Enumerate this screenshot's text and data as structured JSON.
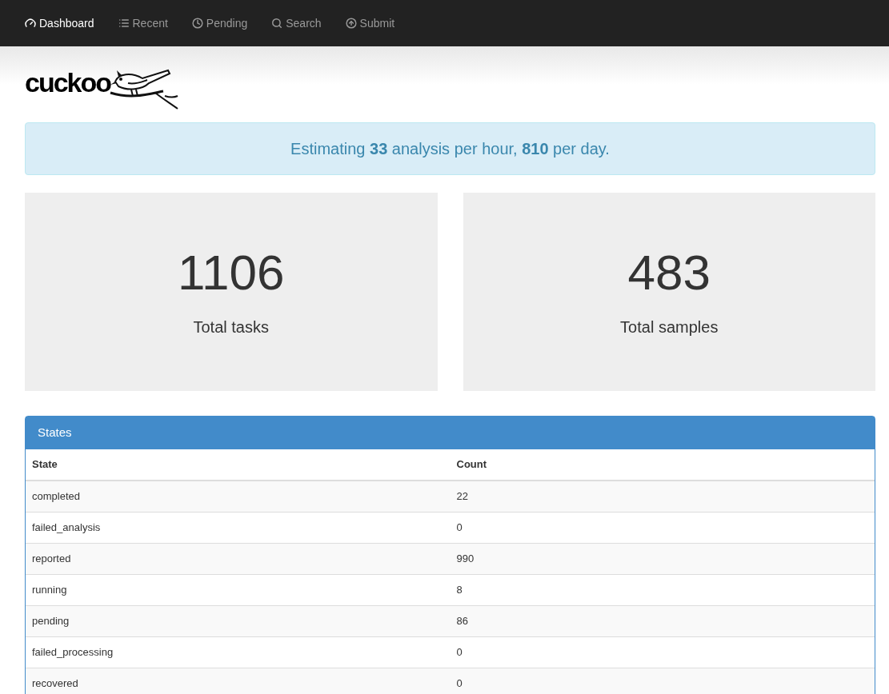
{
  "nav": [
    {
      "label": "Dashboard",
      "kind": "dashboard",
      "selected": true
    },
    {
      "label": "Recent",
      "kind": "list",
      "selected": false
    },
    {
      "label": "Pending",
      "kind": "clock",
      "selected": false
    },
    {
      "label": "Search",
      "kind": "search",
      "selected": false
    },
    {
      "label": "Submit",
      "kind": "upload",
      "selected": false
    }
  ],
  "logo": {
    "text": "cuckoo"
  },
  "alert": "Estimating **33** analysis per hour, **810** per day.",
  "stats": [
    {
      "value": "1106",
      "label": "Total tasks"
    },
    {
      "value": "483",
      "label": "Total samples"
    }
  ],
  "states_panel": {
    "title": "States",
    "columns": [
      "State",
      "Count"
    ],
    "rows": [
      [
        "completed",
        "22"
      ],
      [
        "failed_analysis",
        "0"
      ],
      [
        "reported",
        "990"
      ],
      [
        "running",
        "8"
      ],
      [
        "pending",
        "86"
      ],
      [
        "failed_processing",
        "0"
      ],
      [
        "recovered",
        "0"
      ]
    ]
  }
}
